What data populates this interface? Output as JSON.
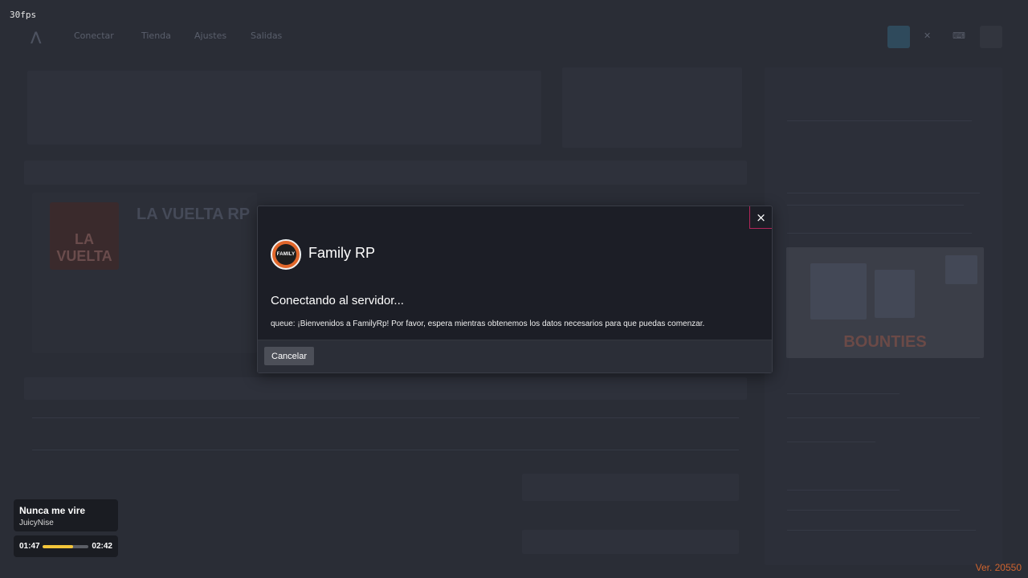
{
  "overlay": {
    "fps": "30fps",
    "version": "Ver. 20550"
  },
  "background": {
    "nav": [
      "Conectar",
      "Tienda",
      "Ajustes",
      "Salidas"
    ],
    "server_card_art_text": "LA VUELTA",
    "server_title": "LA VUELTA RP",
    "news_image_text": "BOUNTIES"
  },
  "music_player": {
    "song_title": "Nunca me vire",
    "artist": "JuicyNise",
    "elapsed": "01:47",
    "duration": "02:42",
    "progress": 0.66
  },
  "modal": {
    "close_label": "×",
    "server_logo_text": "FAMILY",
    "server_name": "Family RP",
    "status": "Conectando al servidor...",
    "message": "queue: ¡Bienvenidos a FamilyRp! Por favor, espera mientras obtenemos los datos necesarios para que puedas comenzar.",
    "cancel_label": "Cancelar"
  },
  "colors": {
    "accent_progress": "#f3c53a",
    "close_border": "#b3265a",
    "version_text": "#d0642f",
    "logo_orange": "#e1672b"
  }
}
